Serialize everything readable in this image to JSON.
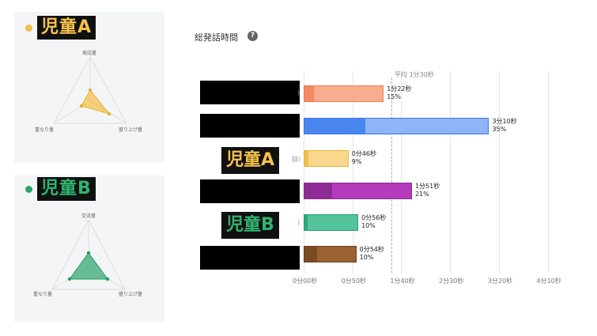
{
  "students": [
    {
      "id": "a",
      "name": "児童A",
      "color": "#f0c04a",
      "name_color": "#f6c24b",
      "fill": "rgba(246,190,70,0.7)",
      "stroke": "#e9b032",
      "axes": [
        "発話量",
        "盛り上げ量",
        "重なり量"
      ]
    },
    {
      "id": "b",
      "name": "児童B",
      "color": "#29a86a",
      "name_color": "#2fb56f",
      "fill": "rgba(55,170,120,0.75)",
      "stroke": "#2a9a62",
      "axes": [
        "交流量",
        "盛り上げ量",
        "重なり量"
      ]
    }
  ],
  "chart_title": "総発話時間",
  "help_icon": "?",
  "average_label": "平均 1分30秒",
  "overlays": [
    "児童A",
    "児童B"
  ],
  "label_fragments": [
    ")",
    "録)",
    ")"
  ],
  "chart_data": {
    "type": "bar",
    "orientation": "horizontal",
    "x_unit": "seconds",
    "xlim": [
      0,
      250
    ],
    "x_ticks": [
      "0分00秒",
      "0分50秒",
      "1分40秒",
      "2分30秒",
      "3分20秒",
      "4分10秒"
    ],
    "average_seconds": 90,
    "bars": [
      {
        "time": "1分22秒",
        "pct": "15%",
        "seconds": 82,
        "dark_seconds": 10,
        "light": "#f9ad90",
        "dark": "#f48a62",
        "edge": "#f07b52"
      },
      {
        "time": "3分10秒",
        "pct": "35%",
        "seconds": 190,
        "dark_seconds": 62,
        "light": "#8fb4f7",
        "dark": "#4a86f0",
        "edge": "#3d78e2"
      },
      {
        "time": "0分46秒",
        "pct": "9%",
        "seconds": 46,
        "dark_seconds": 4,
        "light": "#f7d88c",
        "dark": "#f1c04e",
        "edge": "#eab33f"
      },
      {
        "time": "1分51秒",
        "pct": "21%",
        "seconds": 111,
        "dark_seconds": 28,
        "light": "#b43cbc",
        "dark": "#8e2b96",
        "edge": "#8a2890"
      },
      {
        "time": "0分56秒",
        "pct": "10%",
        "seconds": 56,
        "dark_seconds": 3,
        "light": "#53c49b",
        "dark": "#2fa87c",
        "edge": "#2a9d71"
      },
      {
        "time": "0分54秒",
        "pct": "10%",
        "seconds": 54,
        "dark_seconds": 13,
        "light": "#9a6232",
        "dark": "#7a4a22",
        "edge": "#6d421e"
      }
    ]
  }
}
